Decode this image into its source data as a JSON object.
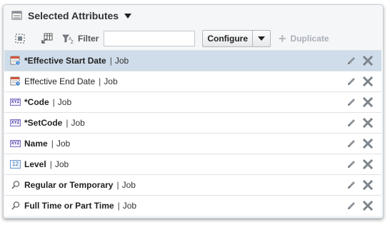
{
  "header": {
    "title": "Selected Attributes"
  },
  "toolbar": {
    "filter_label": "Filter",
    "filter_value": "",
    "configure_label": "Configure",
    "duplicate_label": "Duplicate"
  },
  "rows": [
    {
      "name": "*Effective Start Date",
      "context": "Job",
      "icon": "calendar-icon",
      "bold": true,
      "selected": true
    },
    {
      "name": "Effective End Date",
      "context": "Job",
      "icon": "calendar-icon",
      "bold": false,
      "selected": false
    },
    {
      "name": "*Code",
      "context": "Job",
      "icon": "text-type-icon",
      "bold": true,
      "selected": false
    },
    {
      "name": "*SetCode",
      "context": "Job",
      "icon": "text-type-icon",
      "bold": true,
      "selected": false
    },
    {
      "name": "Name",
      "context": "Job",
      "icon": "text-type-icon",
      "bold": true,
      "selected": false
    },
    {
      "name": "Level",
      "context": "Job",
      "icon": "number-type-icon",
      "bold": true,
      "selected": false
    },
    {
      "name": "Regular or Temporary",
      "context": "Job",
      "icon": "lookup-search-icon",
      "bold": true,
      "selected": false
    },
    {
      "name": "Full Time or Part Time",
      "context": "Job",
      "icon": "lookup-search-icon",
      "bold": true,
      "selected": false
    }
  ],
  "icons": {
    "text_type": "XYZ",
    "number_type": "12"
  },
  "colors": {
    "selected_row": "#cfdcea",
    "panel_bg": "#f4f6f8"
  }
}
